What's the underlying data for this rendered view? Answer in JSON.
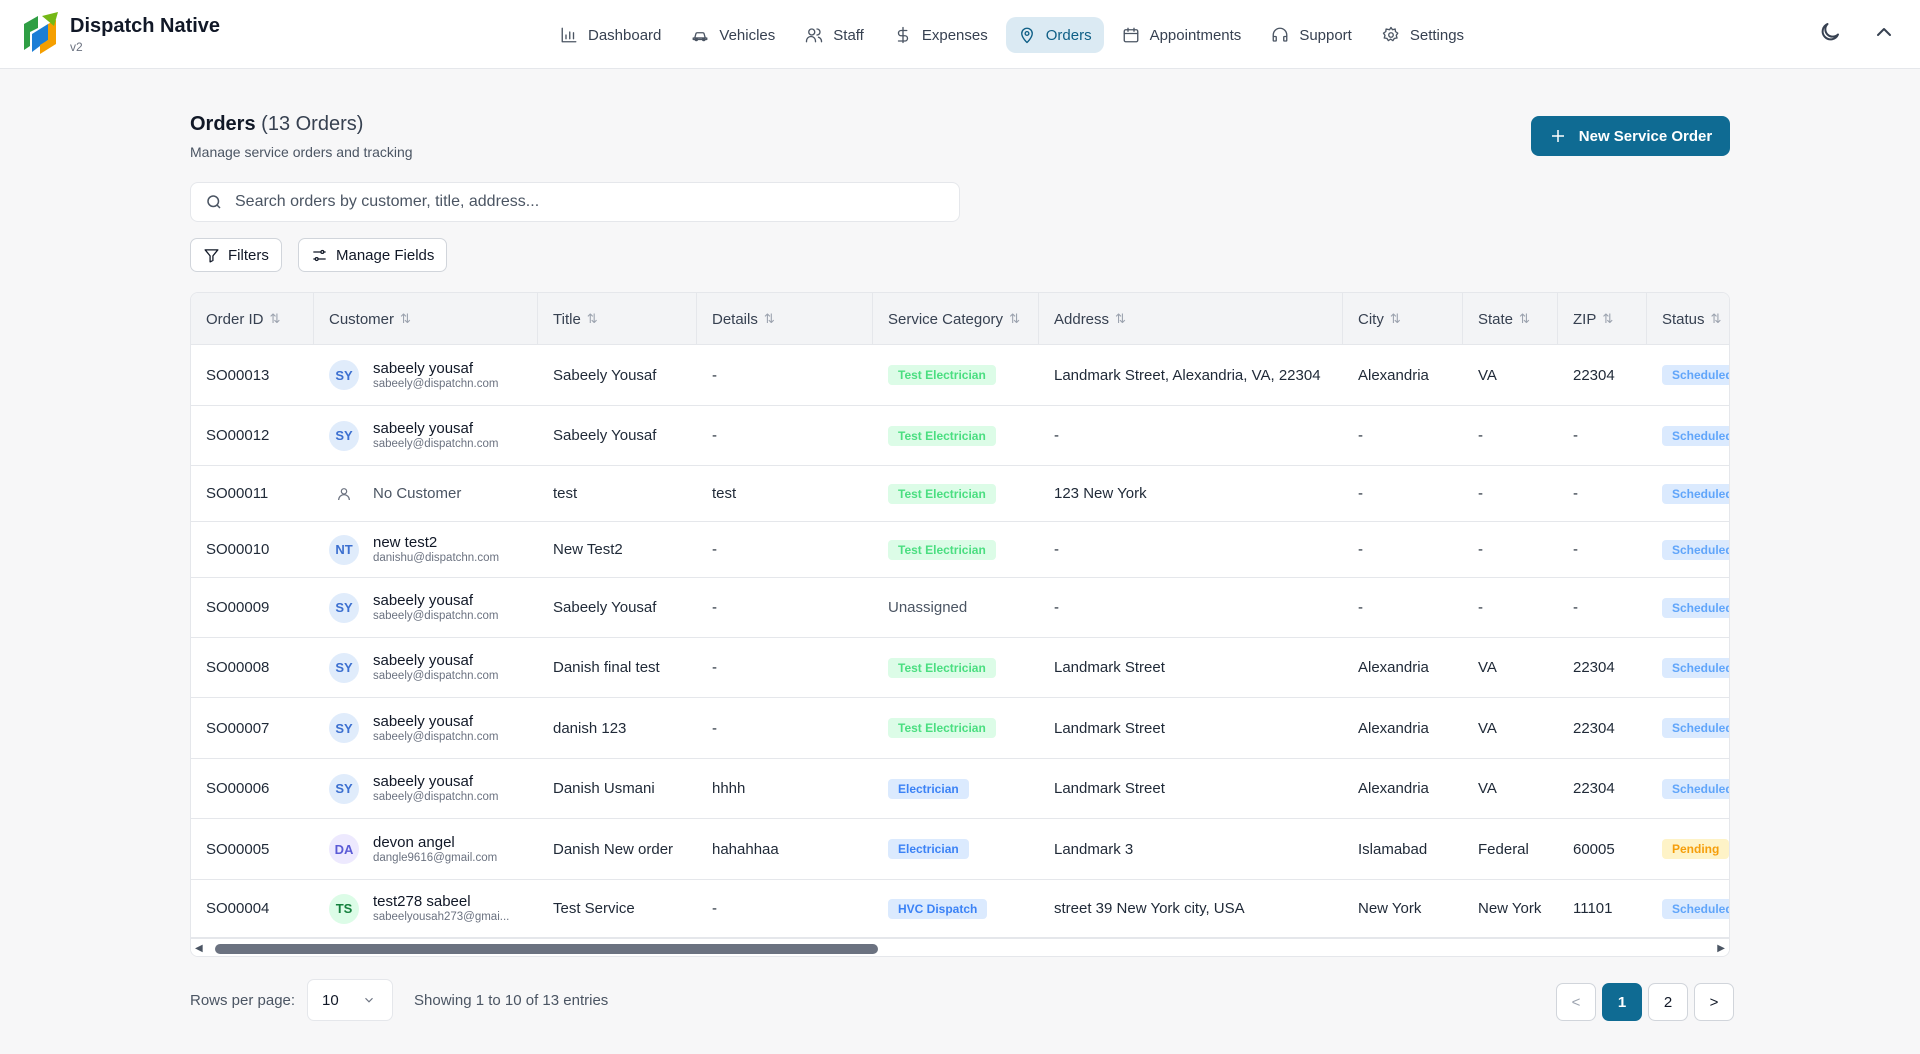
{
  "brand": {
    "name": "Dispatch Native",
    "version": "v2"
  },
  "nav": [
    {
      "label": "Dashboard",
      "icon": "chart-icon"
    },
    {
      "label": "Vehicles",
      "icon": "car-icon"
    },
    {
      "label": "Staff",
      "icon": "users-icon"
    },
    {
      "label": "Expenses",
      "icon": "dollar-icon"
    },
    {
      "label": "Orders",
      "icon": "map-pin-icon",
      "active": true
    },
    {
      "label": "Appointments",
      "icon": "calendar-icon"
    },
    {
      "label": "Support",
      "icon": "headset-icon"
    },
    {
      "label": "Settings",
      "icon": "gear-icon"
    }
  ],
  "page": {
    "title": "Orders",
    "count": "(13 Orders)",
    "subtitle": "Manage service orders and tracking",
    "new_button": "New Service Order",
    "search_placeholder": "Search orders by customer, title, address...",
    "filters_label": "Filters",
    "manage_fields_label": "Manage Fields"
  },
  "table": {
    "headers": [
      "Order ID",
      "Customer",
      "Title",
      "Details",
      "Service Category",
      "Address",
      "City",
      "State",
      "ZIP",
      "Status"
    ],
    "rows": [
      {
        "id": "SO00013",
        "initials": "SY",
        "name": "sabeely yousaf",
        "email": "sabeely@dispatchn.com",
        "title": "Sabeely Yousaf",
        "details": "-",
        "category": "Test Electrician",
        "address": "Landmark Street, Alexandria, VA, 22304",
        "city": "Alexandria",
        "state": "VA",
        "zip": "22304",
        "status": "Scheduled"
      },
      {
        "id": "SO00012",
        "initials": "SY",
        "name": "sabeely yousaf",
        "email": "sabeely@dispatchn.com",
        "title": "Sabeely Yousaf",
        "details": "-",
        "category": "Test Electrician",
        "address": "-",
        "city": "-",
        "state": "-",
        "zip": "-",
        "status": "Scheduled"
      },
      {
        "id": "SO00011",
        "initials": "",
        "name": "No Customer",
        "email": "",
        "title": "test",
        "details": "test",
        "category": "Test Electrician",
        "address": "123 New York",
        "city": "-",
        "state": "-",
        "zip": "-",
        "status": "Scheduled"
      },
      {
        "id": "SO00010",
        "initials": "NT",
        "name": "new test2",
        "email": "danishu@dispatchn.com",
        "title": "New Test2",
        "details": "-",
        "category": "Test Electrician",
        "address": "-",
        "city": "-",
        "state": "-",
        "zip": "-",
        "status": "Scheduled"
      },
      {
        "id": "SO00009",
        "initials": "SY",
        "name": "sabeely yousaf",
        "email": "sabeely@dispatchn.com",
        "title": "Sabeely Yousaf",
        "details": "-",
        "category": "Unassigned",
        "address": "-",
        "city": "-",
        "state": "-",
        "zip": "-",
        "status": "Scheduled"
      },
      {
        "id": "SO00008",
        "initials": "SY",
        "name": "sabeely yousaf",
        "email": "sabeely@dispatchn.com",
        "title": "Danish final test",
        "details": "-",
        "category": "Test Electrician",
        "address": "Landmark Street",
        "city": "Alexandria",
        "state": "VA",
        "zip": "22304",
        "status": "Scheduled"
      },
      {
        "id": "SO00007",
        "initials": "SY",
        "name": "sabeely yousaf",
        "email": "sabeely@dispatchn.com",
        "title": "danish 123",
        "details": "-",
        "category": "Test Electrician",
        "address": "Landmark Street",
        "city": "Alexandria",
        "state": "VA",
        "zip": "22304",
        "status": "Scheduled"
      },
      {
        "id": "SO00006",
        "initials": "SY",
        "name": "sabeely yousaf",
        "email": "sabeely@dispatchn.com",
        "title": "Danish Usmani",
        "details": "hhhh",
        "category": "Electrician",
        "address": "Landmark Street",
        "city": "Alexandria",
        "state": "VA",
        "zip": "22304",
        "status": "Scheduled"
      },
      {
        "id": "SO00005",
        "initials": "DA",
        "name": "devon angel",
        "email": "dangle9616@gmail.com",
        "title": "Danish New order",
        "details": "hahahhaa",
        "category": "Electrician",
        "address": "Landmark 3",
        "city": "Islamabad",
        "state": "Federal",
        "zip": "60005",
        "status": "Pending"
      },
      {
        "id": "SO00004",
        "initials": "TS",
        "name": "test278 sabeel",
        "email": "sabeelyousah273@gmai...",
        "title": "Test Service",
        "details": "-",
        "category": "HVC Dispatch",
        "address": "street 39 New York city, USA",
        "city": "New York",
        "state": "New York",
        "zip": "11101",
        "status": "Scheduled"
      }
    ]
  },
  "footer": {
    "rows_per_page_label": "Rows per page:",
    "rows_per_page": "10",
    "showing": "Showing 1 to 10 of 13 entries",
    "prev": "<",
    "next": ">",
    "pages": [
      "1",
      "2"
    ]
  }
}
